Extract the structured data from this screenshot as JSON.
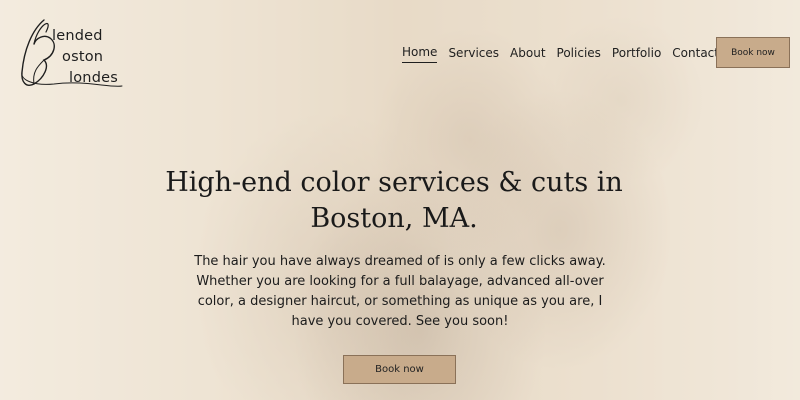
{
  "brand": {
    "logo_lines": [
      "lended",
      "oston",
      "londes"
    ],
    "logo_initials": "B B B"
  },
  "nav": {
    "items": [
      {
        "label": "Home",
        "active": true
      },
      {
        "label": "Services",
        "active": false
      },
      {
        "label": "About",
        "active": false
      },
      {
        "label": "Policies",
        "active": false
      },
      {
        "label": "Portfolio",
        "active": false
      },
      {
        "label": "Contact",
        "active": false
      }
    ],
    "social_icon": "instagram-icon",
    "book_label": "Book now"
  },
  "hero": {
    "headline": "High-end color services & cuts in Boston, MA.",
    "body": "The hair you have always dreamed of is only a few clicks away. Whether you are looking for a full balayage, advanced all-over color, a designer haircut, or something as unique as you are, I have you covered. See you soon!",
    "cta_label": "Book now"
  },
  "colors": {
    "button_bg": "#c8ab8b",
    "button_border": "#8a7158",
    "text": "#1c1c1c"
  }
}
